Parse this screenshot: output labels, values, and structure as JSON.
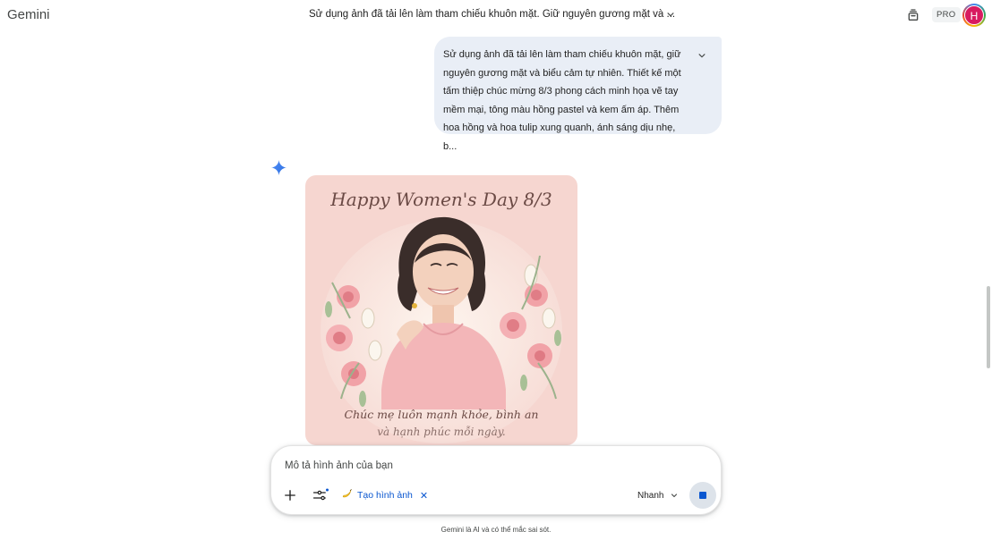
{
  "app": {
    "name": "Gemini"
  },
  "header": {
    "conversation_title": "Sử dụng ảnh đã tải lên làm tham chiếu khuôn mặt. Giữ nguyên gương mặt và ...",
    "plan_badge": "PRO",
    "avatar_letter": "H"
  },
  "user_message": {
    "text": "Sử dụng ảnh đã tải lên làm tham chiếu khuôn mặt, giữ nguyên gương mặt và biểu cảm tự nhiên. Thiết kế một tấm thiệp chúc mừng 8/3 phong cách minh họa vẽ tay mềm mại, tông màu hồng pastel và kem ấm áp. Thêm hoa hồng và hoa tulip xung quanh, ánh sáng dịu nhẹ, b..."
  },
  "generated_image": {
    "title_text": "Happy Women's Day 8/3",
    "caption_line1": "Chúc mẹ luôn mạnh khỏe, bình an",
    "caption_line2": "và hạnh phúc mỗi ngày."
  },
  "composer": {
    "placeholder": "Mô tả hình ảnh của bạn",
    "tool_chip_icon": "banana-icon",
    "tool_chip_label": "Tạo hình ảnh",
    "mode_label": "Nhanh"
  },
  "footer": {
    "disclaimer": "Gemini là AI và có thể mắc sai sót."
  },
  "colors": {
    "accent": "#0b57d0",
    "user_bubble": "#e9eef6",
    "avatar_bg": "#d81b60"
  }
}
